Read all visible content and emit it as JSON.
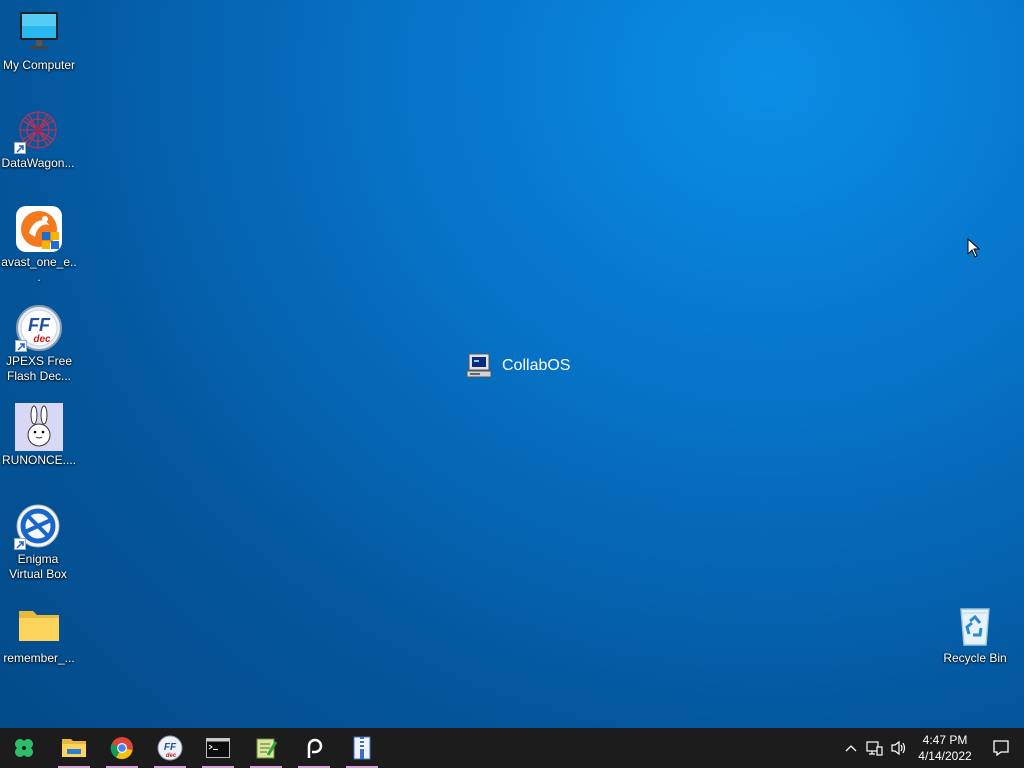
{
  "desktop": {
    "icons": [
      {
        "label": "My Computer",
        "icon": "monitor-icon"
      },
      {
        "label": "DataWagon...",
        "icon": "datawagon-icon"
      },
      {
        "label": "avast_one_e...",
        "icon": "avast-icon"
      },
      {
        "label": "JPEXS Free Flash Dec...",
        "icon": "ffdec-icon"
      },
      {
        "label": "RUNONCE....",
        "icon": "bunny-icon"
      },
      {
        "label": "Enigma Virtual Box",
        "icon": "enigma-icon"
      },
      {
        "label": "remember_...",
        "icon": "folder-icon"
      },
      {
        "label": "Recycle Bin",
        "icon": "recycle-bin-icon"
      }
    ],
    "center_label": "CollabOS",
    "ffdec_text": {
      "ff": "FF",
      "dec": "dec"
    }
  },
  "taskbar": {
    "apps": [
      {
        "name": "start",
        "icon": "clover-icon"
      },
      {
        "name": "file-explorer",
        "icon": "folder-icon"
      },
      {
        "name": "chrome",
        "icon": "chrome-icon"
      },
      {
        "name": "ffdec",
        "icon": "ffdec-icon"
      },
      {
        "name": "terminal",
        "icon": "terminal-icon"
      },
      {
        "name": "notepad",
        "icon": "notepad-icon"
      },
      {
        "name": "p-app",
        "icon": "p-icon"
      },
      {
        "name": "archive",
        "icon": "archive-icon"
      }
    ],
    "clock": {
      "time": "4:47 PM",
      "date": "4/14/2022"
    }
  },
  "colors": {
    "taskbar": "#1c1c1c",
    "underline": "#d6a3d6",
    "desktop_accent": "#0672c6"
  }
}
